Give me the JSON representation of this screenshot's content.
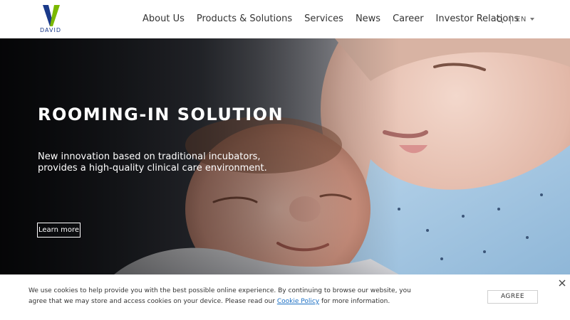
{
  "header": {
    "logo_text": "DAVID",
    "nav": [
      {
        "label": "About Us"
      },
      {
        "label": "Products & Solutions"
      },
      {
        "label": "Services"
      },
      {
        "label": "News"
      },
      {
        "label": "Career"
      },
      {
        "label": "Investor Relations"
      }
    ],
    "search_icon": "search-icon",
    "language": "EN",
    "language_icon": "chevron-down-icon"
  },
  "hero": {
    "title": "ROOMING-IN SOLUTION",
    "subtitle_line1": "New innovation based on traditional incubators,",
    "subtitle_line2": "provides a high-quality clinical care environment.",
    "button_label": "Learn more"
  },
  "cookie": {
    "text_line1": "We use cookies to help provide you with the best possible online experience. By continuing to browse our website, you",
    "text_line2_before": "agree that we may store and access cookies on your device. Please read our ",
    "link_label": "Cookie Policy",
    "text_line2_after": " for more information.",
    "agree_label": "AGREE",
    "close_icon": "close-icon"
  },
  "colors": {
    "brand_green": "#7ab800",
    "brand_blue": "#1b3a8a",
    "link": "#1a6fc4"
  }
}
